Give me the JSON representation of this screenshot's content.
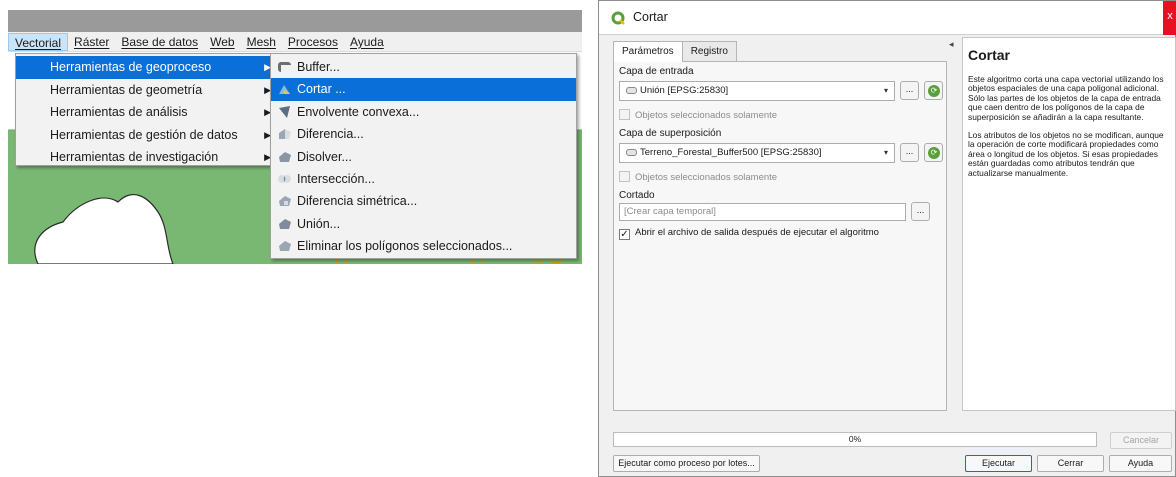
{
  "menubar": {
    "items": [
      "Vectorial",
      "Ráster",
      "Base de datos",
      "Web",
      "Mesh",
      "Procesos",
      "Ayuda"
    ]
  },
  "vector_menu": {
    "items": [
      "Herramientas de geoproceso",
      "Herramientas de geometría",
      "Herramientas de análisis",
      "Herramientas de gestión de datos",
      "Herramientas de investigación"
    ],
    "selected": "Herramientas de geoproceso"
  },
  "geoprocess_submenu": {
    "items": [
      {
        "label": "Buffer...",
        "icon": "buffer-icon"
      },
      {
        "label": "Cortar ...",
        "icon": "clip-icon"
      },
      {
        "label": "Envolvente convexa...",
        "icon": "convex-hull-icon"
      },
      {
        "label": "Diferencia...",
        "icon": "difference-icon"
      },
      {
        "label": "Disolver...",
        "icon": "dissolve-icon"
      },
      {
        "label": "Intersección...",
        "icon": "intersection-icon"
      },
      {
        "label": "Diferencia simétrica...",
        "icon": "symmetrical-difference-icon"
      },
      {
        "label": "Unión...",
        "icon": "union-icon"
      },
      {
        "label": "Eliminar los polígonos seleccionados...",
        "icon": "eliminate-icon"
      }
    ],
    "selected": "Cortar ..."
  },
  "dialog": {
    "title": "Cortar",
    "close_glyph": "x",
    "tabs": [
      "Parámetros",
      "Registro"
    ],
    "active_tab": "Parámetros",
    "input_layer": {
      "label": "Capa de entrada",
      "value": "Unión [EPSG:25830]",
      "selected_only_label": "Objetos seleccionados solamente",
      "selected_only_checked": false
    },
    "overlay_layer": {
      "label": "Capa de superposición",
      "value": "Terreno_Forestal_Buffer500 [EPSG:25830]",
      "selected_only_label": "Objetos seleccionados solamente",
      "selected_only_checked": false
    },
    "output": {
      "label": "Cortado",
      "placeholder": "[Crear capa temporal]",
      "open_after_label": "Abrir el archivo de salida después de ejecutar el algoritmo",
      "open_after_checked": true
    },
    "browse_label": "...",
    "help": {
      "title": "Cortar",
      "paragraph1": "Este algoritmo corta una capa vectorial utilizando los objetos espaciales de una capa poligonal adicional. Sólo las partes de los objetos de la capa de entrada que caen dentro de los polígonos de la capa de superposición se añadirán a la capa resultante.",
      "paragraph2": "Los atributos de los objetos no se modifican, aunque la operación de corte modificará propiedades como área o longitud de los objetos. Si esas propiedades están guardadas como atributos tendrán que actualizarse manualmente."
    },
    "progress_text": "0%",
    "progress_value": 0,
    "buttons": {
      "cancel": "Cancelar",
      "batch": "Ejecutar como proceso por lotes...",
      "run": "Ejecutar",
      "close": "Cerrar",
      "help": "Ayuda"
    }
  },
  "colors": {
    "selection": "#0a6fd8",
    "map_green": "#79b873",
    "close_red": "#e81123",
    "qgis_green": "#5aa03a"
  }
}
